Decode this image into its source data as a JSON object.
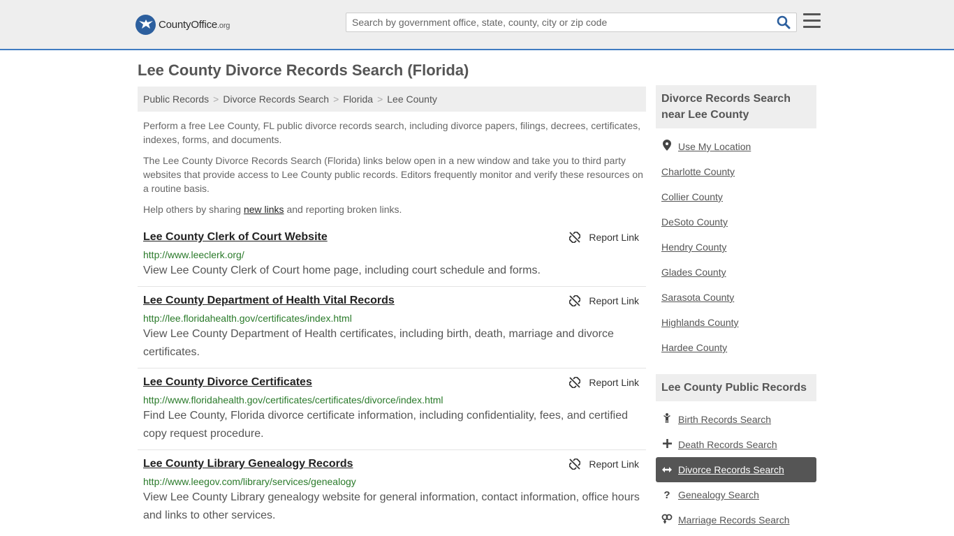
{
  "header": {
    "logo_brand": "CountyOffice",
    "logo_suffix": ".org",
    "search_placeholder": "Search by government office, state, county, city or zip code"
  },
  "page": {
    "title": "Lee County Divorce Records Search (Florida)"
  },
  "breadcrumb": [
    "Public Records",
    "Divorce Records Search",
    "Florida",
    "Lee County"
  ],
  "intro": {
    "p1": "Perform a free Lee County, FL public divorce records search, including divorce papers, filings, decrees, certificates, indexes, forms, and documents.",
    "p2": "The Lee County Divorce Records Search (Florida) links below open in a new window and take you to third party websites that provide access to Lee County public records. Editors frequently monitor and verify these resources on a routine basis.",
    "p3_before": "Help others by sharing ",
    "p3_link": "new links",
    "p3_after": " and reporting broken links."
  },
  "report_label": "Report Link",
  "results": [
    {
      "title": "Lee County Clerk of Court Website",
      "url": "http://www.leeclerk.org/",
      "desc": "View Lee County Clerk of Court home page, including court schedule and forms."
    },
    {
      "title": "Lee County Department of Health Vital Records",
      "url": "http://lee.floridahealth.gov/certificates/index.html",
      "desc": "View Lee County Department of Health certificates, including birth, death, marriage and divorce certificates."
    },
    {
      "title": "Lee County Divorce Certificates",
      "url": "http://www.floridahealth.gov/certificates/certificates/divorce/index.html",
      "desc": "Find Lee County, Florida divorce certificate information, including confidentiality, fees, and certified copy request procedure."
    },
    {
      "title": "Lee County Library Genealogy Records",
      "url": "http://www.leegov.com/library/services/genealogy",
      "desc": "View Lee County Library genealogy website for general information, contact information, office hours and links to other services."
    }
  ],
  "sidebar": {
    "nearby_heading": "Divorce Records Search near Lee County",
    "use_location": "Use My Location",
    "nearby": [
      "Charlotte County",
      "Collier County",
      "DeSoto County",
      "Hendry County",
      "Glades County",
      "Sarasota County",
      "Highlands County",
      "Hardee County"
    ],
    "public_heading": "Lee County Public Records",
    "public_links": [
      {
        "label": "Birth Records Search",
        "icon": "child-icon"
      },
      {
        "label": "Death Records Search",
        "icon": "plus-icon"
      },
      {
        "label": "Divorce Records Search",
        "icon": "arrows-horizontal-icon"
      },
      {
        "label": "Genealogy Search",
        "icon": "question-icon"
      },
      {
        "label": "Marriage Records Search",
        "icon": "marriage-icon"
      }
    ]
  },
  "colors": {
    "header_bg": "#eeeeee",
    "header_border": "#3f7cc1",
    "url_green": "#2a7a2a",
    "active_bg": "#555555"
  }
}
